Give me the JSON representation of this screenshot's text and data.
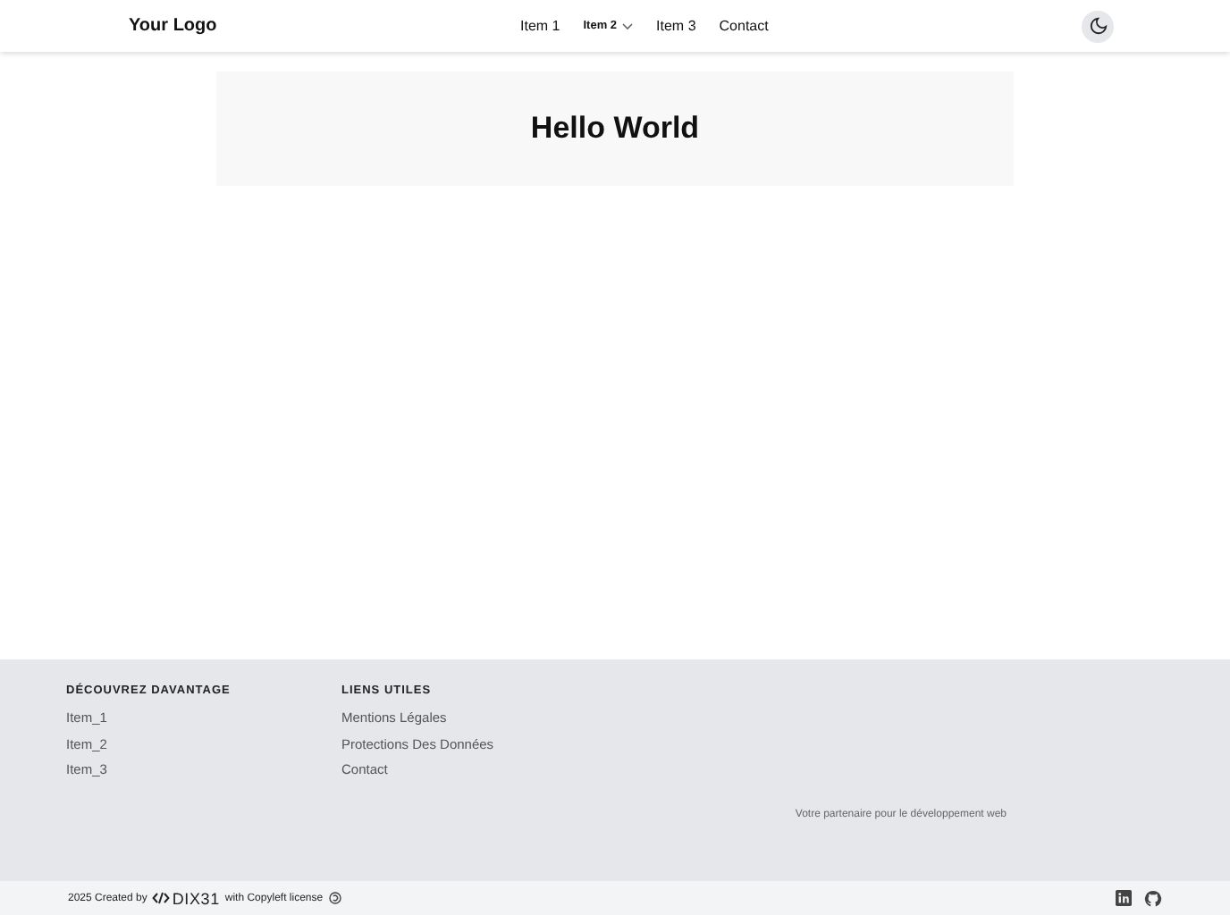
{
  "header": {
    "logo": "Your Logo",
    "nav": [
      {
        "label": "Item 1",
        "dropdown": false
      },
      {
        "label": "Item 2",
        "dropdown": true
      },
      {
        "label": "Item 3",
        "dropdown": false
      },
      {
        "label": "Contact",
        "dropdown": false
      }
    ]
  },
  "hero": {
    "title": "Hello World"
  },
  "footer": {
    "columns": [
      {
        "heading": "DÉCOUVREZ DAVANTAGE",
        "links": [
          "Item_1",
          "Item_2",
          "Item_3"
        ]
      },
      {
        "heading": "LIENS UTILES",
        "links": [
          "Mentions Légales",
          "Protections Des Données",
          "Contact"
        ]
      }
    ],
    "tagline": "Votre partenaire pour le développement web",
    "bottom": {
      "year": "2025 Created by",
      "brand": "DIX31",
      "license": "with Copyleft license"
    }
  }
}
